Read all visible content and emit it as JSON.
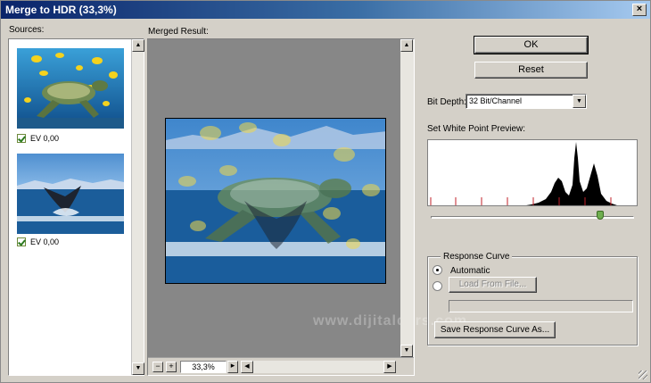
{
  "window": {
    "title": "Merge to HDR (33,3%)",
    "close_glyph": "×"
  },
  "sources": {
    "label": "Sources:",
    "items": [
      {
        "image": "turtle-fish-thumbnail",
        "ev_label": "EV 0,00",
        "checked": true
      },
      {
        "image": "whale-tail-thumbnail",
        "ev_label": "EV 0,00",
        "checked": true
      }
    ]
  },
  "merged": {
    "label": "Merged Result:",
    "zoom_value": "33,3%",
    "zoom_out_glyph": "−",
    "zoom_in_glyph": "+",
    "zoom_menu_glyph": "▸",
    "watermark": "www.dijitalders.com"
  },
  "buttons": {
    "ok": "OK",
    "reset": "Reset"
  },
  "bit_depth": {
    "label": "Bit Depth:",
    "value": "32 Bit/Channel"
  },
  "white_point": {
    "label": "Set White Point Preview:",
    "slider_fraction": 0.82
  },
  "response_curve": {
    "title": "Response Curve",
    "automatic_label": "Automatic",
    "automatic_selected": true,
    "load_button": "Load From File...",
    "save_button": "Save Response Curve As..."
  },
  "colors": {
    "titlebar_start": "#0a246a",
    "panel_bg": "#d4d0c8",
    "histogram_marker": "#c0202a"
  }
}
